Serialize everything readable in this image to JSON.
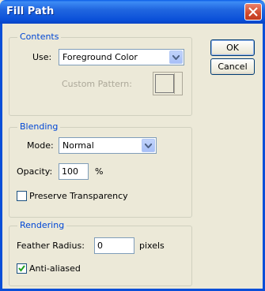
{
  "window": {
    "title": "Fill Path"
  },
  "buttons": {
    "ok": "OK",
    "cancel": "Cancel"
  },
  "contents": {
    "legend": "Contents",
    "use_label": "Use:",
    "use_value": "Foreground Color",
    "custom_pattern_label": "Custom Pattern:"
  },
  "blending": {
    "legend": "Blending",
    "mode_label": "Mode:",
    "mode_value": "Normal",
    "opacity_label": "Opacity:",
    "opacity_value": "100",
    "opacity_unit": "%",
    "preserve_transparency_label": "Preserve Transparency",
    "preserve_transparency_checked": false
  },
  "rendering": {
    "legend": "Rendering",
    "feather_label": "Feather Radius:",
    "feather_value": "0",
    "feather_unit": "pixels",
    "antialiased_label": "Anti-aliased",
    "antialiased_checked": true
  },
  "colors": {
    "title_bar": "#0a4fd8",
    "dialog_bg": "#ece9d8",
    "group_legend": "#0046d5",
    "close_button": "#d04a2c"
  }
}
